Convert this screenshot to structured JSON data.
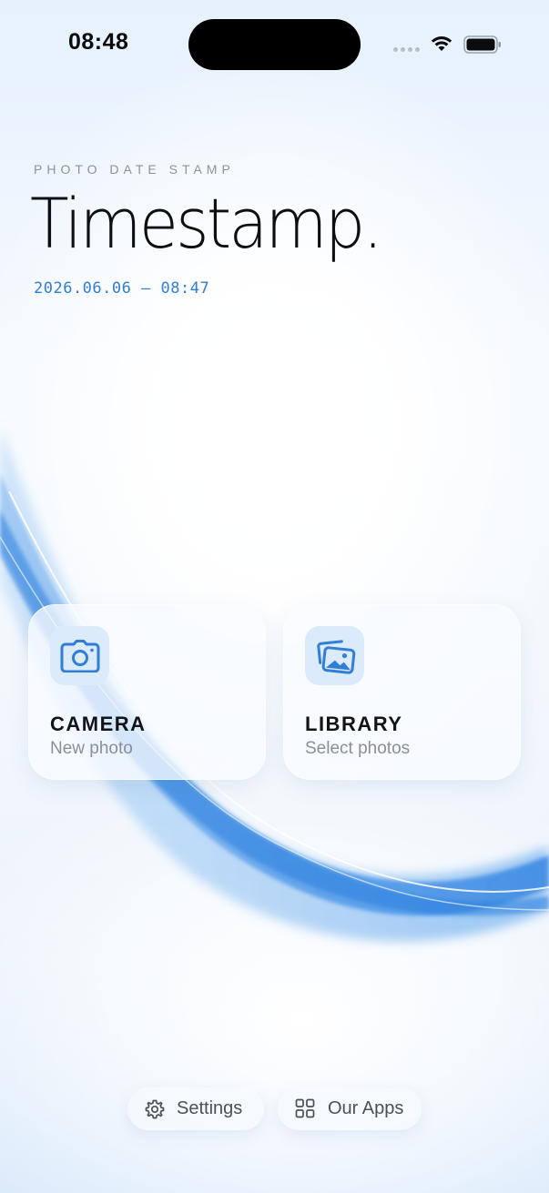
{
  "status_bar": {
    "time": "08:48"
  },
  "header": {
    "eyebrow": "PHOTO DATE STAMP",
    "title": "Timestamp.",
    "datestamp": "2026.06.06 — 08:47"
  },
  "actions": [
    {
      "title": "CAMERA",
      "subtitle": "New photo",
      "icon": "camera-icon"
    },
    {
      "title": "LIBRARY",
      "subtitle": "Select photos",
      "icon": "photo-library-icon"
    }
  ],
  "footer": {
    "settings_label": "Settings",
    "settings_icon": "gear-icon",
    "apps_label": "Our Apps",
    "apps_icon": "grid-icon"
  },
  "colors": {
    "accent": "#2f7ed8",
    "icon_tile": "#dcebfb",
    "title_text": "#0d0f12",
    "muted_text": "#8a8f96"
  }
}
